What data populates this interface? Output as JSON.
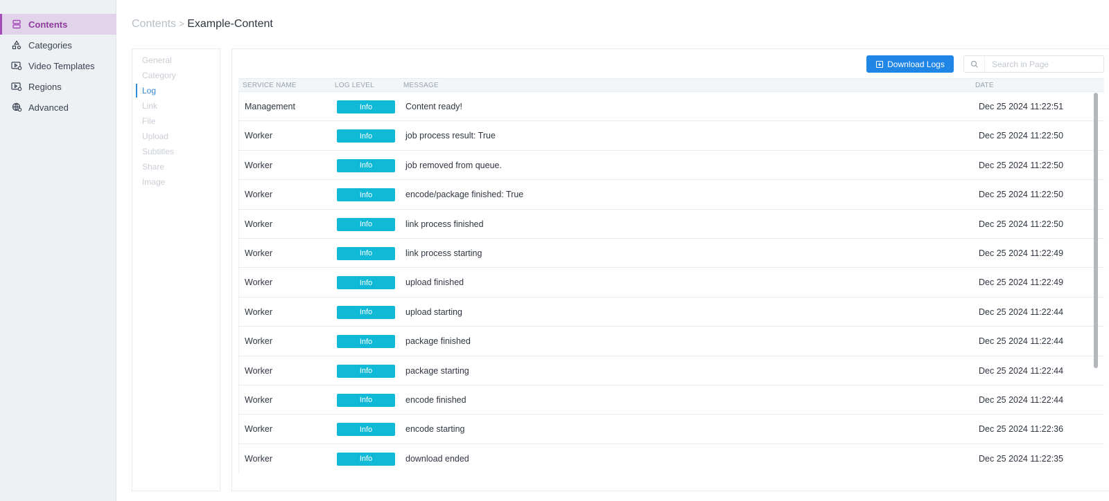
{
  "sidebar": {
    "items": [
      {
        "label": "Contents",
        "icon": "server-icon"
      },
      {
        "label": "Categories",
        "icon": "shapes-icon"
      },
      {
        "label": "Video Templates",
        "icon": "video-settings-icon"
      },
      {
        "label": "Regions",
        "icon": "video-settings-icon"
      },
      {
        "label": "Advanced",
        "icon": "globe-gear-icon"
      }
    ],
    "active_color": "#a44cb8"
  },
  "breadcrumb": {
    "parent": "Contents",
    "separator": ">",
    "current": "Example-Content"
  },
  "subnav": {
    "items": [
      "General",
      "Category",
      "Log",
      "Link",
      "File",
      "Upload",
      "Subtitles",
      "Share",
      "Image"
    ],
    "active": "Log"
  },
  "toolbar": {
    "download_label": "Download Logs",
    "search_placeholder": "Search in Page"
  },
  "table": {
    "headers": {
      "service": "SERVICE NAME",
      "level": "LOG LEVEL",
      "message": "MESSAGE",
      "date": "DATE"
    },
    "rows": [
      {
        "service": "Management",
        "level": "Info",
        "message": "Content ready!",
        "date": "Dec 25 2024 11:22:51"
      },
      {
        "service": "Worker",
        "level": "Info",
        "message": "job process result: True",
        "date": "Dec 25 2024 11:22:50"
      },
      {
        "service": "Worker",
        "level": "Info",
        "message": "job removed from queue.",
        "date": "Dec 25 2024 11:22:50"
      },
      {
        "service": "Worker",
        "level": "Info",
        "message": "encode/package finished: True",
        "date": "Dec 25 2024 11:22:50"
      },
      {
        "service": "Worker",
        "level": "Info",
        "message": "link process finished",
        "date": "Dec 25 2024 11:22:50"
      },
      {
        "service": "Worker",
        "level": "Info",
        "message": "link process starting",
        "date": "Dec 25 2024 11:22:49"
      },
      {
        "service": "Worker",
        "level": "Info",
        "message": "upload finished",
        "date": "Dec 25 2024 11:22:49"
      },
      {
        "service": "Worker",
        "level": "Info",
        "message": "upload starting",
        "date": "Dec 25 2024 11:22:44"
      },
      {
        "service": "Worker",
        "level": "Info",
        "message": "package finished",
        "date": "Dec 25 2024 11:22:44"
      },
      {
        "service": "Worker",
        "level": "Info",
        "message": "package starting",
        "date": "Dec 25 2024 11:22:44"
      },
      {
        "service": "Worker",
        "level": "Info",
        "message": "encode finished",
        "date": "Dec 25 2024 11:22:44"
      },
      {
        "service": "Worker",
        "level": "Info",
        "message": "encode starting",
        "date": "Dec 25 2024 11:22:36"
      },
      {
        "service": "Worker",
        "level": "Info",
        "message": "download ended",
        "date": "Dec 25 2024 11:22:35"
      }
    ],
    "badge_color": "#10b9d6"
  },
  "colors": {
    "primary_button": "#1f86e6",
    "subnav_active": "#2f8bd6"
  }
}
